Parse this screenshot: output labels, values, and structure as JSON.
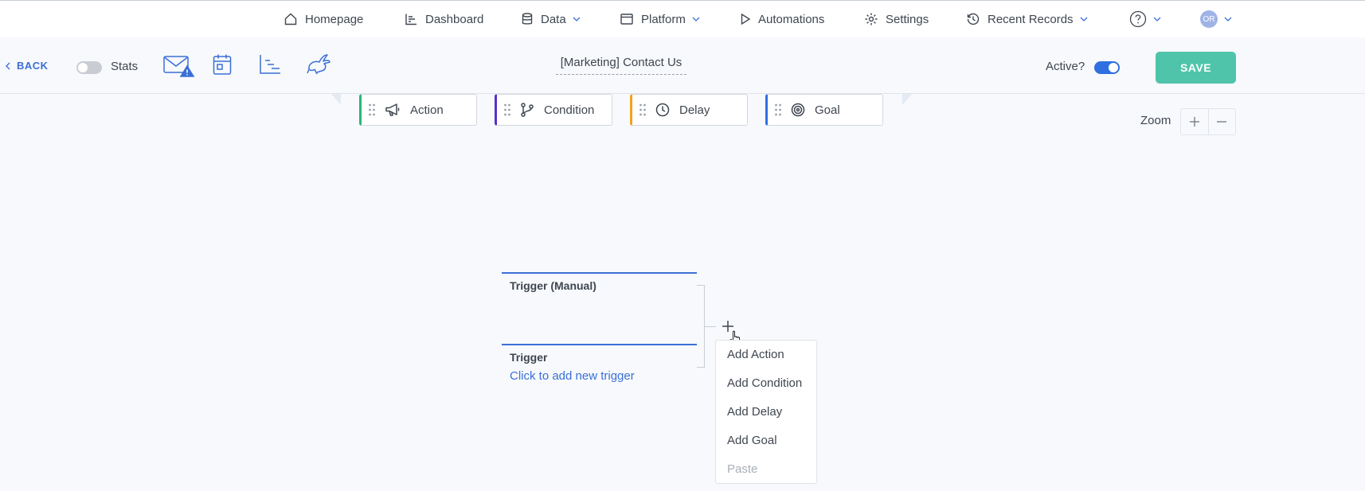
{
  "nav": {
    "items": [
      {
        "label": "Homepage",
        "icon": "home-icon"
      },
      {
        "label": "Dashboard",
        "icon": "chart-icon"
      },
      {
        "label": "Data",
        "icon": "database-icon",
        "dropdown": true
      },
      {
        "label": "Platform",
        "icon": "window-icon",
        "dropdown": true
      },
      {
        "label": "Automations",
        "icon": "play-icon"
      },
      {
        "label": "Settings",
        "icon": "gear-icon"
      },
      {
        "label": "Recent Records",
        "icon": "history-icon",
        "dropdown": true
      }
    ],
    "help_icon": "help-icon",
    "avatar_initials": "OR"
  },
  "toolbar": {
    "back_label": "BACK",
    "stats_label": "Stats",
    "stats_enabled": false,
    "tool_icons": [
      "email-warning-icon",
      "calendar-icon",
      "timeline-chart-icon",
      "rabbit-icon"
    ],
    "workflow_title": "[Marketing] Contact Us",
    "active_label": "Active?",
    "active_enabled": true,
    "save_label": "SAVE"
  },
  "palette": [
    {
      "label": "Action",
      "icon": "megaphone-icon",
      "accent": "#2bb673"
    },
    {
      "label": "Condition",
      "icon": "branch-icon",
      "accent": "#5b2fc9"
    },
    {
      "label": "Delay",
      "icon": "clock-icon",
      "accent": "#f2a21b"
    },
    {
      "label": "Goal",
      "icon": "target-icon",
      "accent": "#2f6fe0"
    }
  ],
  "zoom": {
    "label": "Zoom"
  },
  "canvas": {
    "trigger_manual_title": "Trigger (Manual)",
    "trigger_title": "Trigger",
    "trigger_link": "Click to add new trigger"
  },
  "context_menu": {
    "items": [
      {
        "label": "Add Action",
        "enabled": true
      },
      {
        "label": "Add Condition",
        "enabled": true
      },
      {
        "label": "Add Delay",
        "enabled": true
      },
      {
        "label": "Add Goal",
        "enabled": true
      },
      {
        "label": "Paste",
        "enabled": false
      }
    ]
  },
  "colors": {
    "brand_blue": "#3b6fd6",
    "save_green": "#4fc4aa",
    "toggle_on": "#2f6fe0",
    "toggle_off": "#c9cdd3"
  }
}
